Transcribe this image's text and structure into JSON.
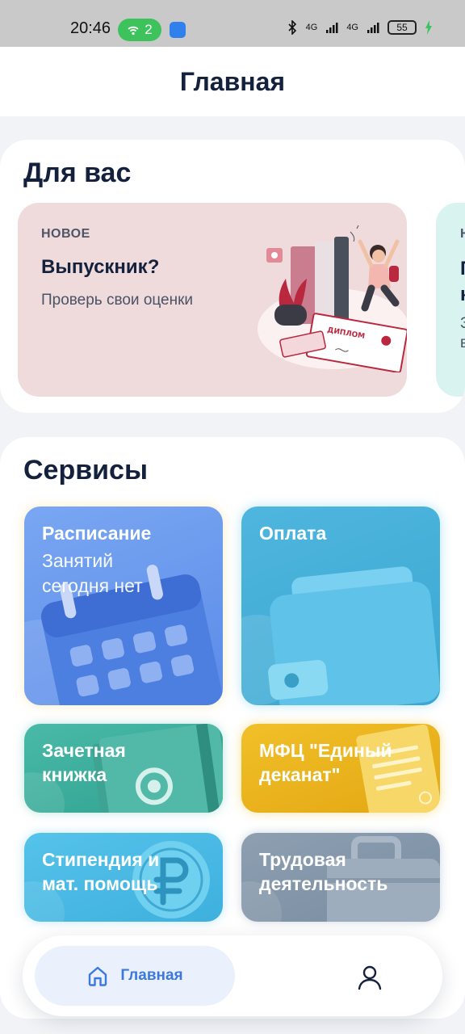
{
  "status_bar": {
    "time": "20:46",
    "hotspot_count": "2",
    "network_1": "4G",
    "network_2": "4G",
    "battery": "55"
  },
  "header": {
    "title": "Главная"
  },
  "for_you": {
    "title": "Для вас",
    "cards": [
      {
        "tag": "НОВОЕ",
        "title": "Выпускник?",
        "subtitle": "Проверь свои оценки",
        "art_text": "ДИПЛОМ",
        "background": "#f0dbdc"
      },
      {
        "tag": "Н",
        "title": "П\nк",
        "subtitle": "З\nв",
        "background": "#d9f3f0"
      }
    ]
  },
  "services": {
    "title": "Сервисы",
    "tiles": [
      {
        "label": "Расписание",
        "subtitle": "Занятий\nсегодня нет",
        "icon": "calendar-icon",
        "color": "#6a98ee"
      },
      {
        "label": "Оплата",
        "icon": "wallet-icon",
        "color": "#45b0d9"
      },
      {
        "label": "Зачетная\nкнижка",
        "icon": "book-icon",
        "color": "#3bae9c"
      },
      {
        "label": "МФЦ \"Единый\nдеканат\"",
        "icon": "document-icon",
        "color": "#eab31e"
      },
      {
        "label": "Стипендия и\nмат. помощь",
        "icon": "ruble-coin-icon",
        "color": "#4bbbe4"
      },
      {
        "label": "Трудовая\nдеятельность",
        "icon": "briefcase-icon",
        "color": "#8497ab"
      }
    ]
  },
  "bottom_nav": {
    "items": [
      {
        "label": "Главная",
        "icon": "home-icon",
        "active": true
      },
      {
        "label": "",
        "icon": "profile-icon",
        "active": false
      }
    ],
    "active_color": "#3b78e0"
  }
}
